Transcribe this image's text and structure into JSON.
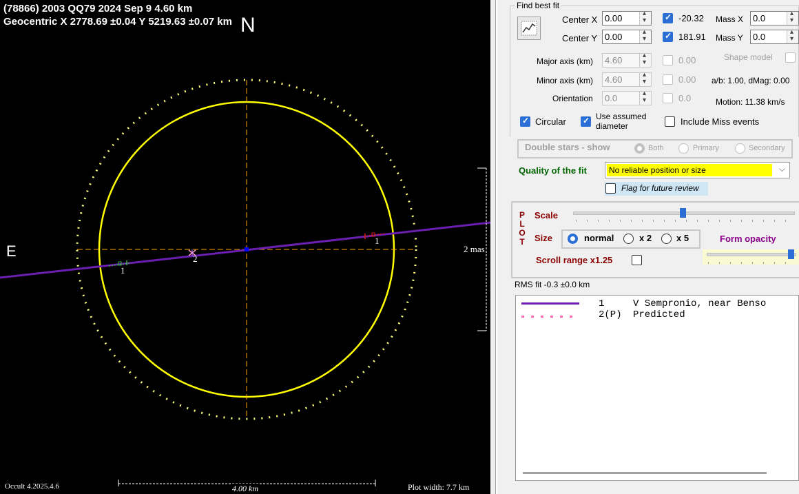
{
  "plot": {
    "title_line1": "(78866) 2003 QQ79  2024 Sep 9  4.60 km",
    "title_line2": "Geocentric  X  2778.69 ±0.04  Y 5219.63 ±0.07 km",
    "north_label": "N",
    "east_label": "E",
    "scale_label": "2 mas",
    "version_label": "Occult 4.2025.4.6",
    "width_bar_label": "4.00 km",
    "plot_width_label": "Plot width: 7.7 km",
    "chord1_label": "1",
    "chord2_label": "2",
    "chord1b_label": "1",
    "colors": {
      "ellipse": "#ffff00",
      "axes": "#ffa500",
      "chord": "#6a1fb0",
      "center": "#0000ff"
    }
  },
  "find_best_fit": {
    "group_title": "Find best fit",
    "button_icon": "chart-icon",
    "center_x_label": "Center X",
    "center_x_value": "0.00",
    "center_x_checked": true,
    "center_x_result": "-20.32",
    "mass_x_label": "Mass X",
    "mass_x_value": "0.0",
    "center_y_label": "Center Y",
    "center_y_value": "0.00",
    "center_y_checked": true,
    "center_y_result": "181.91",
    "mass_y_label": "Mass Y",
    "mass_y_value": "0.0",
    "major_label": "Major axis (km)",
    "major_value": "4.60",
    "major_result": "0.00",
    "shape_model_label": "Shape model",
    "minor_label": "Minor axis (km)",
    "minor_value": "4.60",
    "minor_result": "0.00",
    "ab_dmag": "a/b: 1.00, dMag: 0.00",
    "orientation_label": "Orientation",
    "orientation_value": "0.0",
    "orientation_result": "0.0",
    "motion": "Motion: 11.38 km/s",
    "circular_label": "Circular",
    "use_diam_label_1": "Use assumed",
    "use_diam_label_2": "diameter",
    "include_miss_label": "Include Miss events"
  },
  "double_stars": {
    "label": "Double stars - show",
    "both": "Both",
    "primary": "Primary",
    "secondary": "Secondary"
  },
  "quality": {
    "label": "Quality of the fit",
    "value": "No reliable position or size",
    "flag_label": "Flag for future review"
  },
  "plot_controls": {
    "vertical_label": [
      "P",
      "L",
      "O",
      "T"
    ],
    "scale_label": "Scale",
    "size_label": "Size",
    "normal": "normal",
    "x2": "x 2",
    "x5": "x 5",
    "form_opacity": "Form opacity",
    "scroll_range": "Scroll range x1.25"
  },
  "rms": "RMS fit -0.3 ±0.0 km",
  "legend": [
    {
      "num": "1",
      "text": "V Sempronio, near Benso",
      "style": "solid",
      "color": "#6a1fb0"
    },
    {
      "num": "2(P)",
      "text": "Predicted",
      "style": "dotted",
      "color": "#ff69b4"
    }
  ]
}
